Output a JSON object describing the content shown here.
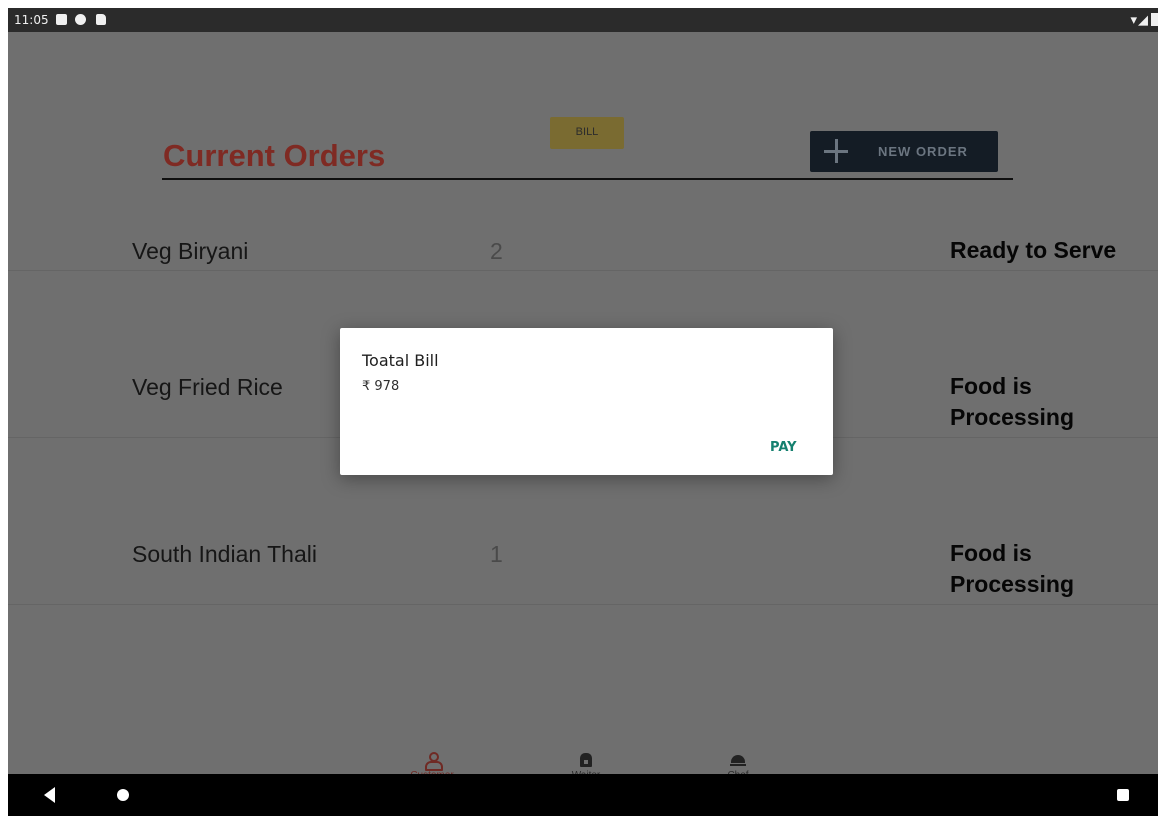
{
  "status_bar": {
    "time": "11:05"
  },
  "header": {
    "title": "Current Orders",
    "bill_label": "BILL",
    "new_order_label": "NEW ORDER"
  },
  "orders": [
    {
      "name": "Veg Biryani",
      "qty": "2",
      "status": "Ready to Serve"
    },
    {
      "name": "Veg Fried Rice",
      "qty": "",
      "status": "Food is Processing"
    },
    {
      "name": "South Indian Thali",
      "qty": "1",
      "status": "Food is Processing"
    }
  ],
  "dialog": {
    "title": "Toatal Bill",
    "amount": "₹ 978",
    "pay_label": "PAY"
  },
  "bottom_nav": {
    "items": [
      {
        "label": "Customer",
        "icon": "person-icon",
        "active": true
      },
      {
        "label": "Waiter",
        "icon": "shop-icon",
        "active": false
      },
      {
        "label": "Chef",
        "icon": "cloche-icon",
        "active": false
      }
    ]
  },
  "colors": {
    "title": "#b33a31",
    "bill_button": "#d8b94f",
    "new_order_button": "#1d2a3a",
    "pay": "#15806f",
    "active_nav": "#c0392b"
  }
}
